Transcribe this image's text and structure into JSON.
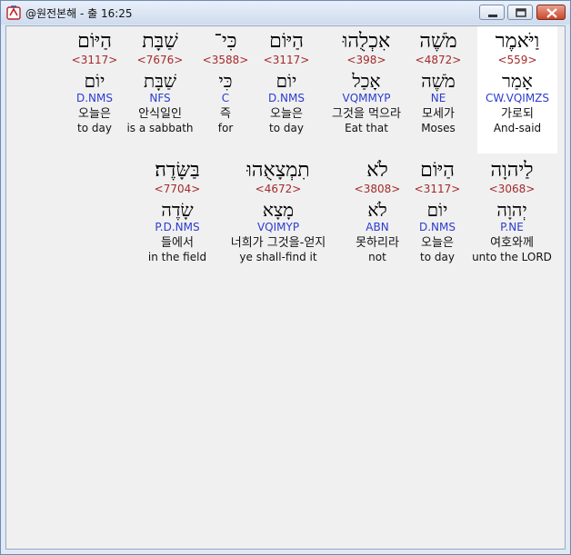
{
  "window": {
    "title": "@원전본해 - 출 16:25",
    "colors": {
      "strong": "#a52a2a",
      "parse": "#2b3ccf",
      "close": "#c8472b"
    }
  },
  "rows": [
    {
      "words": [
        {
          "heb": "וַיֹּאמֶר",
          "strong": "<559>",
          "lemma": "אָמַר",
          "parse": "CW.VQIMZS",
          "kor": "가로되",
          "eng": "And-said",
          "selected": true
        },
        {
          "heb": "מֹשֶׁה",
          "strong": "<4872>",
          "lemma": "מֹשֶׁה",
          "parse": "NE",
          "kor": "모세가",
          "eng": "Moses"
        },
        {
          "heb": "אִכְלֻהוּ",
          "strong": "<398>",
          "lemma": "אָכַל",
          "parse": "VQMMYP",
          "kor": "그것을 먹으라",
          "eng": "Eat that"
        },
        {
          "heb": "הַיּוֹם",
          "strong": "<3117>",
          "lemma": "יוֹם",
          "parse": "D.NMS",
          "kor": "오늘은",
          "eng": "to day"
        },
        {
          "heb": "כִּי־",
          "strong": "<3588>",
          "lemma": "כִּי",
          "parse": "C",
          "kor": "즉",
          "eng": "for"
        },
        {
          "heb": "שַׁבָּת",
          "strong": "<7676>",
          "lemma": "שַׁבָּת",
          "parse": "NFS",
          "kor": "안식일인",
          "eng": "is a sabbath"
        },
        {
          "heb": "הַיּוֹם",
          "strong": "<3117>",
          "lemma": "יוֹם",
          "parse": "D.NMS",
          "kor": "오늘은",
          "eng": "to day"
        }
      ]
    },
    {
      "words": [
        {
          "heb": "לַיהוָה",
          "strong": "<3068>",
          "lemma": "יְהוָה",
          "parse": "P.NE",
          "kor": "여호와께",
          "eng": "unto the LORD"
        },
        {
          "heb": "הַיּוֹם",
          "strong": "<3117>",
          "lemma": "יוֹם",
          "parse": "D.NMS",
          "kor": "오늘은",
          "eng": "to day"
        },
        {
          "heb": "לֹא",
          "strong": "<3808>",
          "lemma": "לֹא",
          "parse": "ABN",
          "kor": "못하리라",
          "eng": "not"
        },
        {
          "heb": "תִמְצָאֻהוּ",
          "strong": "<4672>",
          "lemma": "מָצָא",
          "parse": "VQIMYP",
          "kor": "너희가 그것을-얻지",
          "eng": "ye shall-find it"
        },
        {
          "heb": "בַּשָּׂדֶה׃",
          "strong": "<7704>",
          "lemma": "שָׂדֶה",
          "parse": "P.D.NMS",
          "kor": "들에서",
          "eng": "in the field"
        }
      ]
    }
  ]
}
